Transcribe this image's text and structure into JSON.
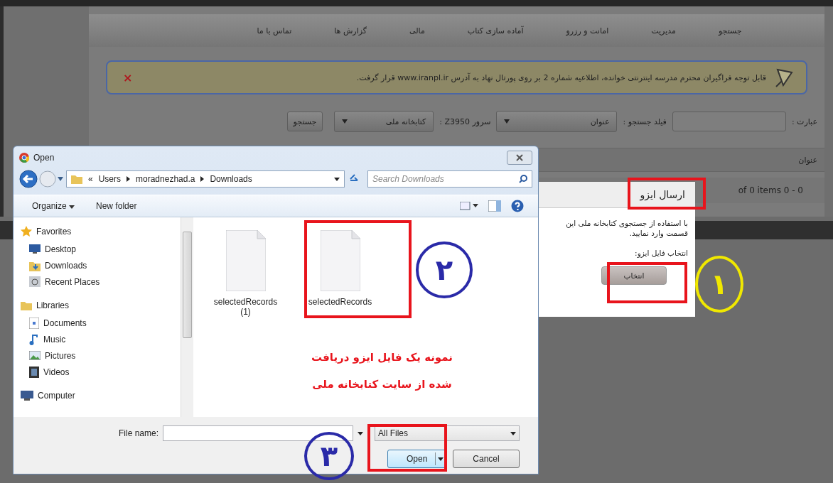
{
  "nav": {
    "items": [
      "جستجو",
      "مدیریت",
      "امانت و رزرو",
      "آماده سازی کتاب",
      "مالی",
      "گزارش ها",
      "تماس با ما"
    ]
  },
  "alert": {
    "text": "قابل توجه فراگیران محترم مدرسه اینترنتی خوانده، اطلاعیه شماره 2 بر روی پورتال نهاد به آدرس www.iranpl.ir قرار گرفت.",
    "close": "×"
  },
  "search": {
    "phrase_label": "عبارت :",
    "field_label": "فیلد جستجو :",
    "field_value": "عنوان",
    "server_label": "سرور Z3950 :",
    "server_value": "کتابخانه ملی",
    "button": "جستجو"
  },
  "table": {
    "columns": [
      "عنوان"
    ],
    "pager": "of 0 items 0 - 0"
  },
  "iso_modal": {
    "title": "ارسال ایزو",
    "description": "با استفاده از جستجوی کتابخانه ملی این قسمت وارد نمایید.",
    "file_label": "انتخاب فایل ایزو:",
    "button": "انتخاب"
  },
  "dialog": {
    "title": "Open",
    "path_prefix": "«",
    "path": {
      "root": "Users",
      "user_folder": "moradnezhad.a",
      "current_folder": "Downloads"
    },
    "search_placeholder": "Search Downloads",
    "toolbar": {
      "organize": "Organize",
      "new_folder": "New folder"
    },
    "sidebar": [
      {
        "label": "Favorites",
        "children": [
          {
            "label": "Desktop"
          },
          {
            "label": "Downloads"
          },
          {
            "label": "Recent Places"
          }
        ]
      },
      {
        "label": "Libraries",
        "children": [
          {
            "label": "Documents"
          },
          {
            "label": "Music"
          },
          {
            "label": "Pictures"
          },
          {
            "label": "Videos"
          }
        ]
      },
      {
        "label": "Computer"
      }
    ],
    "files": {
      "first": {
        "name": "selectedRecords(1)"
      },
      "second": {
        "name": "selectedRecords"
      }
    },
    "file_name_label": "File name:",
    "filter": "All Files",
    "buttons": {
      "open": "Open",
      "cancel": "Cancel"
    }
  },
  "annotations": {
    "steps": [
      {
        "number": "۱",
        "color": "#f0e800"
      },
      {
        "number": "۲",
        "color": "#2a2aa8"
      },
      {
        "number": "۳",
        "color": "#2a2aa8"
      }
    ],
    "caption": [
      "نمونه یک فایل ایزو دریافت",
      "شده از سایت کتابخانه ملی"
    ]
  }
}
